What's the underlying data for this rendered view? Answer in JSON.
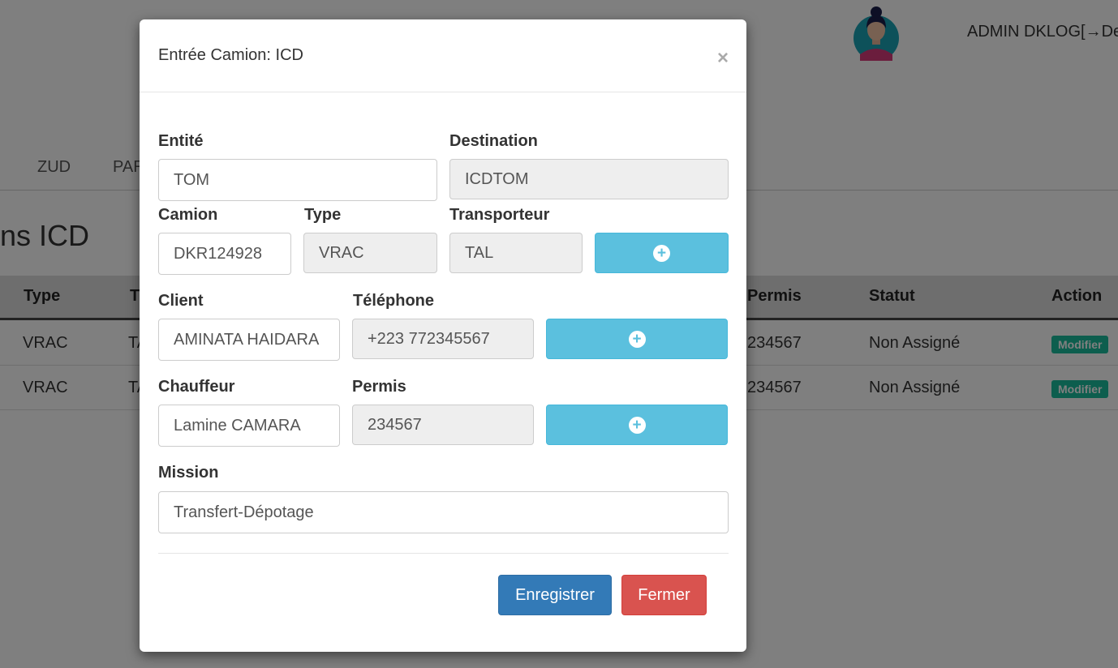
{
  "header": {
    "user_name": "ADMIN DKLOG",
    "logout_icon": "logout-icon",
    "logout_text": "De"
  },
  "nav": {
    "items": [
      "ZUD",
      "PAR"
    ]
  },
  "page": {
    "title": "ns ICD"
  },
  "table": {
    "headers": [
      "Type",
      "T",
      "Permis",
      "Statut",
      "Action"
    ],
    "rows": [
      {
        "type": "VRAC",
        "t": "TA",
        "permis": "234567",
        "statut": "Non Assigné",
        "action": "Modifier"
      },
      {
        "type": "VRAC",
        "t": "TA",
        "permis": "234567",
        "statut": "Non Assigné",
        "action": "Modifier"
      }
    ]
  },
  "modal": {
    "title": "Entrée Camion: ICD",
    "close_symbol": "×",
    "fields": {
      "entite": {
        "label": "Entité",
        "value": "TOM"
      },
      "destination": {
        "label": "Destination",
        "value": "ICDTOM"
      },
      "camion": {
        "label": "Camion",
        "value": "DKR124928"
      },
      "type": {
        "label": "Type",
        "value": "VRAC"
      },
      "transporteur": {
        "label": "Transporteur",
        "value": "TAL"
      },
      "client": {
        "label": "Client",
        "value": "AMINATA HAIDARA"
      },
      "telephone": {
        "label": "Téléphone",
        "value": "+223 772345567"
      },
      "chauffeur": {
        "label": "Chauffeur",
        "value": "Lamine CAMARA"
      },
      "permis": {
        "label": "Permis",
        "value": "234567"
      },
      "mission": {
        "label": "Mission",
        "value": "Transfert-Dépotage"
      }
    },
    "add_symbol": "+",
    "save_label": "Enregistrer",
    "close_label": "Fermer"
  },
  "colors": {
    "primary": "#337ab7",
    "danger": "#d9534f",
    "info": "#5bc0de",
    "success": "#1abc9c"
  }
}
